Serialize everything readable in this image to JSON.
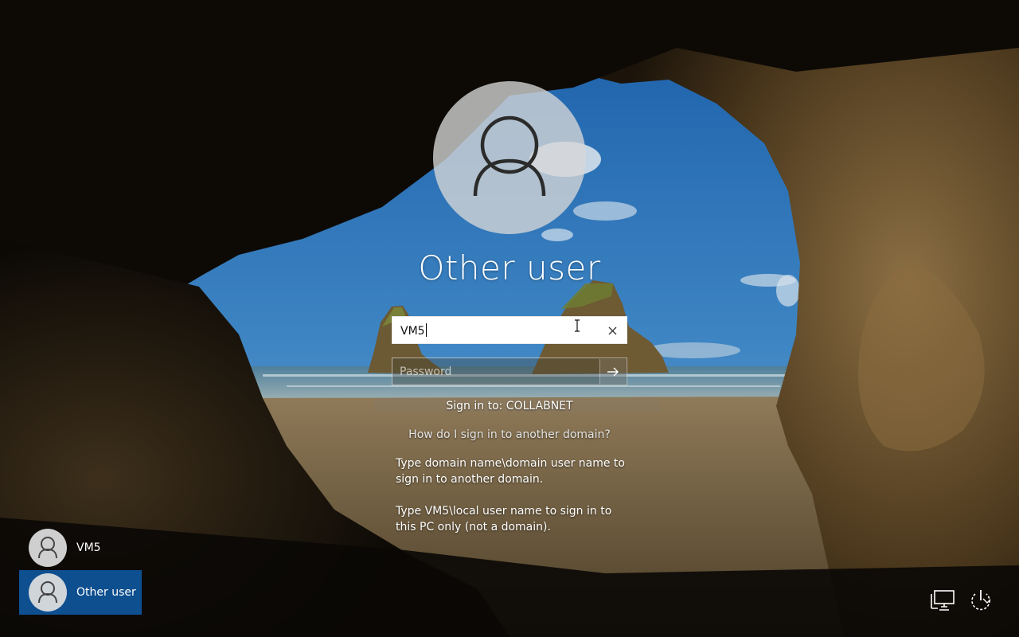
{
  "login": {
    "title": "Other user",
    "username_value": "VM5",
    "password_placeholder": "Password",
    "sign_in_to": "Sign in to: COLLABNET",
    "help_link": "How do I sign in to another domain?",
    "help_text_1": "Type domain name\\domain user name to sign in to another domain.",
    "help_text_2": "Type VM5\\local user name to sign in to this PC only (not a domain)."
  },
  "users": [
    {
      "label": "VM5",
      "selected": false
    },
    {
      "label": "Other user",
      "selected": true
    }
  ],
  "icons": {
    "avatar": "user-silhouette-icon",
    "clear": "close-icon",
    "submit": "arrow-right-icon",
    "network": "network-icon",
    "power": "power-icon"
  },
  "colors": {
    "selected_tile": "#0e4f8f"
  }
}
